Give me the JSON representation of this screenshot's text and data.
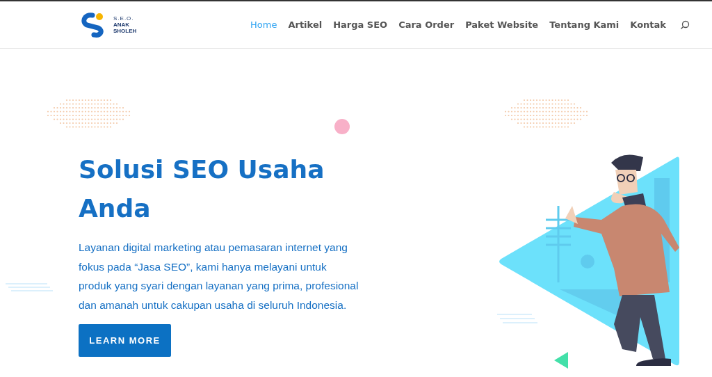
{
  "header": {
    "logo": {
      "line_1": "S.E.O.",
      "line_2": "ANAK",
      "line_3": "SHOLEH"
    },
    "nav": [
      {
        "label": "Home",
        "selected": true
      },
      {
        "label": "Artikel",
        "selected": false
      },
      {
        "label": "Harga SEO",
        "selected": false
      },
      {
        "label": "Cara Order",
        "selected": false
      },
      {
        "label": "Paket Website",
        "selected": false
      },
      {
        "label": "Tentang Kami",
        "selected": false
      },
      {
        "label": "Kontak",
        "selected": false
      }
    ]
  },
  "hero": {
    "title": "Solusi SEO Usaha Anda",
    "description": "Layanan digital marketing atau pemasaran internet yang fokus pada “Jasa SEO”, kami hanya melayani untuk produk yang syari dengan layanan yang prima, profesional dan amanah untuk cakupan usaha di seluruh Indonesia.",
    "button": "LEARN MORE"
  }
}
